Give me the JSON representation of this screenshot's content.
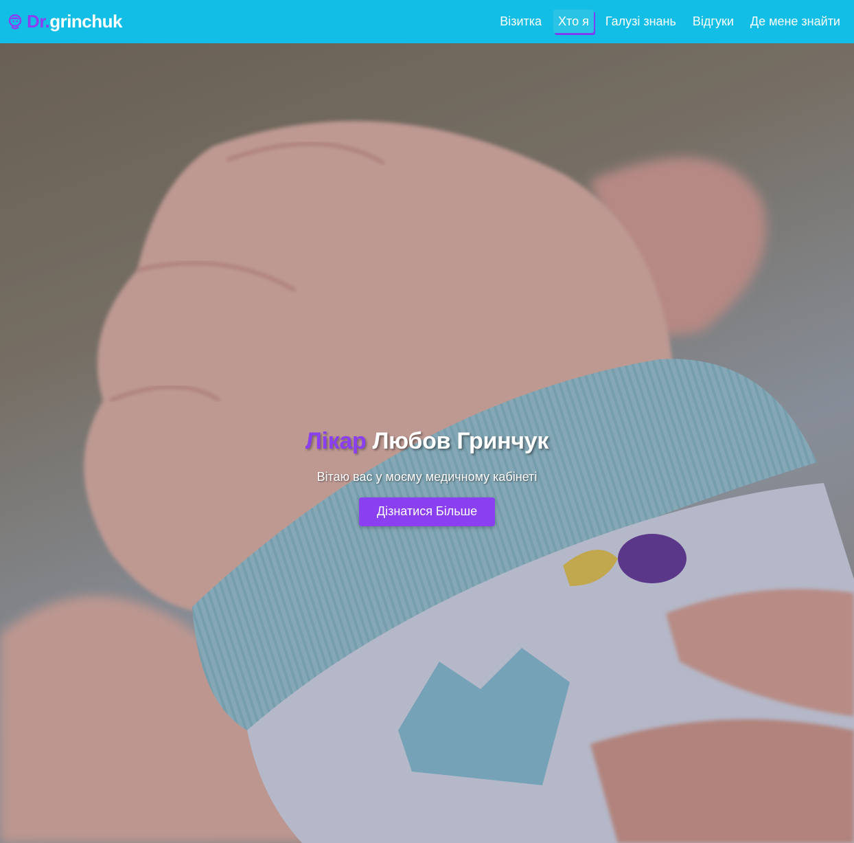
{
  "colors": {
    "navbar_bg": "#12bde6",
    "accent": "#8a3ff0",
    "text_light": "#ffffff"
  },
  "brand": {
    "icon": "doctor-icon",
    "prefix": "Dr.",
    "suffix": "grinchuk"
  },
  "nav": {
    "items": [
      {
        "label": "Візитка",
        "active": false
      },
      {
        "label": "Хто я",
        "active": true
      },
      {
        "label": "Галузі знань",
        "active": false
      },
      {
        "label": "Відгуки",
        "active": false
      },
      {
        "label": "Де мене знайти",
        "active": false
      }
    ]
  },
  "hero": {
    "background": "photo: newborn baby fist wrapped in blue knit sleeve held by adult hand",
    "title_accent": "Лікар",
    "title_rest": "Любов Гринчук",
    "subtitle": "Вітаю вас у моєму медичному кабінеті",
    "button_label": "Дізнатися Більше"
  }
}
